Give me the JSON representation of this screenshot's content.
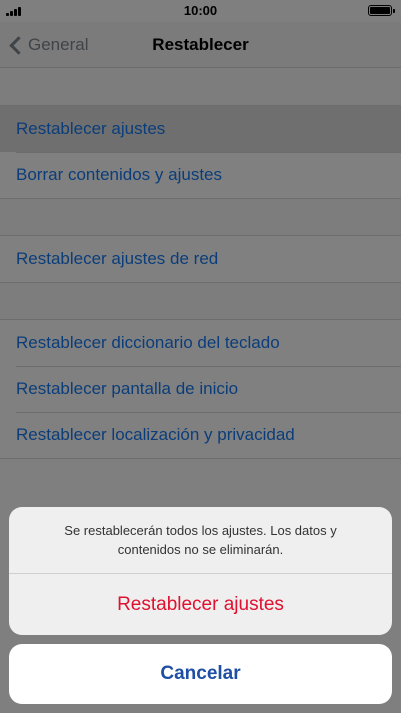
{
  "status_bar": {
    "time": "10:00"
  },
  "nav": {
    "back_label": "General",
    "title": "Restablecer"
  },
  "groups": [
    {
      "items": [
        {
          "label": "Restablecer ajustes"
        },
        {
          "label": "Borrar contenidos y ajustes"
        }
      ]
    },
    {
      "items": [
        {
          "label": "Restablecer ajustes de red"
        }
      ]
    },
    {
      "items": [
        {
          "label": "Restablecer diccionario del teclado"
        },
        {
          "label": "Restablecer pantalla de inicio"
        },
        {
          "label": "Restablecer localización y privacidad"
        }
      ]
    }
  ],
  "action_sheet": {
    "message": "Se restablecerán todos los ajustes. Los datos y contenidos no se eliminarán.",
    "action_label": "Restablecer ajustes",
    "cancel_label": "Cancelar"
  },
  "colors": {
    "link": "#0b3d7a",
    "destructive": "#e0102f",
    "cancel": "#1f4fa3"
  }
}
